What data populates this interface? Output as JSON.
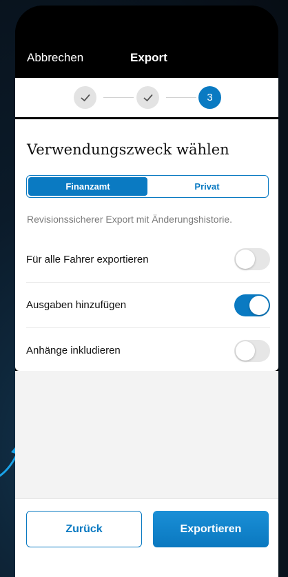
{
  "navbar": {
    "cancel_label": "Abbrechen",
    "title": "Export"
  },
  "stepper": {
    "steps": [
      {
        "state": "done",
        "icon": "checkmark-icon"
      },
      {
        "state": "done",
        "icon": "checkmark-icon"
      },
      {
        "state": "active",
        "label": "3"
      }
    ]
  },
  "main": {
    "title": "Verwendungszweck wählen",
    "segments": [
      {
        "label": "Finanzamt",
        "selected": true
      },
      {
        "label": "Privat",
        "selected": false
      }
    ],
    "hint": "Revisionssicherer Export mit Änderungshistorie.",
    "toggles": [
      {
        "label": "Für alle Fahrer exportieren",
        "on": false
      },
      {
        "label": "Ausgaben hinzufügen",
        "on": true
      },
      {
        "label": "Anhänge inkludieren",
        "on": false
      }
    ]
  },
  "footer": {
    "back_label": "Zurück",
    "export_label": "Exportieren"
  },
  "colors": {
    "accent": "#0a7ac2",
    "toggle_off": "#e6e6e6",
    "step_done": "#e3e3e3"
  }
}
